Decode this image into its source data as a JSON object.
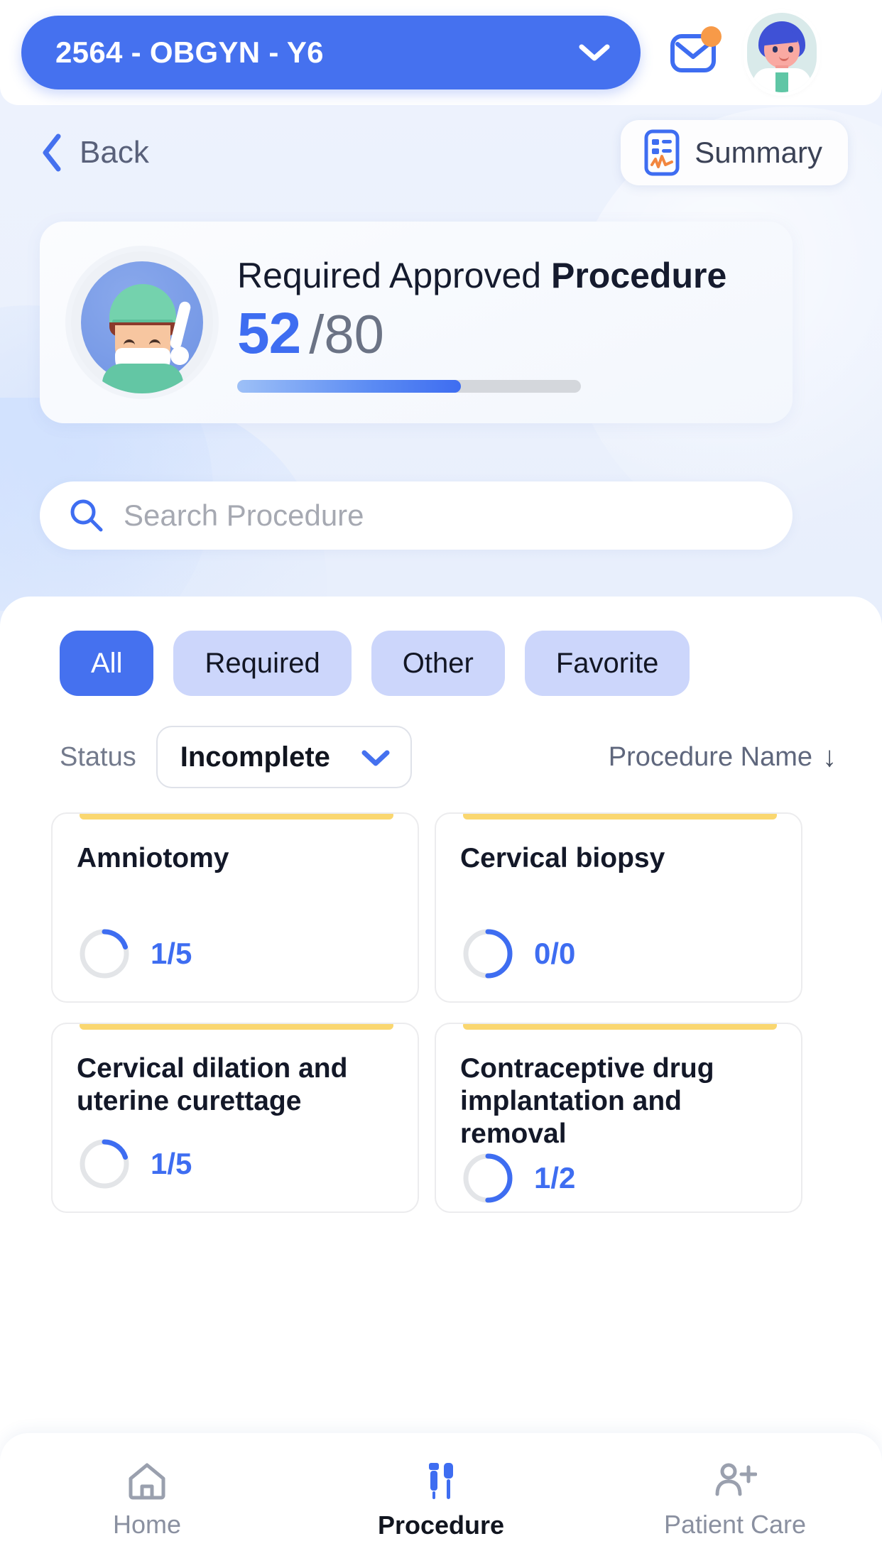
{
  "header": {
    "course_label": "2564 - OBGYN - Y6",
    "chevron_icon": "chevron-down-icon",
    "mail_icon": "mail-icon",
    "mail_has_badge": true,
    "avatar_icon": "user-avatar"
  },
  "navrow": {
    "back_label": "Back",
    "back_icon": "chevron-left-icon",
    "summary_label": "Summary",
    "summary_icon": "report-chart-icon"
  },
  "hero": {
    "title_prefix": "Required Approved ",
    "title_bold": "Procedure",
    "completed": "52",
    "total": "/80",
    "progress_percent": 65,
    "avatar_icon": "surgeon-avatar",
    "accent_color": "#3e6df1",
    "track_color": "#d4d7dc"
  },
  "search": {
    "placeholder": "Search Procedure",
    "icon": "search-icon"
  },
  "filters": {
    "chips": [
      {
        "label": "All",
        "active": true
      },
      {
        "label": "Required",
        "active": false
      },
      {
        "label": "Other",
        "active": false
      },
      {
        "label": "Favorite",
        "active": false
      }
    ],
    "status_label": "Status",
    "status_value": "Incomplete",
    "status_chevron_icon": "chevron-down-icon",
    "sort_label": "Procedure Name",
    "sort_arrow": "↓",
    "sort_icon": "arrow-down-icon"
  },
  "procedures": [
    {
      "name": "Amniotomy",
      "count": "1/5",
      "done": 1,
      "total": 5,
      "percent": 20,
      "accent_color": "#fad770"
    },
    {
      "name": "Cervical biopsy",
      "count": "0/0",
      "done": 0,
      "total": 0,
      "percent": 50,
      "accent_color": "#fad770"
    },
    {
      "name": "Cervical dilation and uterine curettage",
      "count": "1/5",
      "done": 1,
      "total": 5,
      "percent": 20,
      "accent_color": "#fad770"
    },
    {
      "name": "Contraceptive drug implantation and removal",
      "count": "1/2",
      "done": 1,
      "total": 2,
      "percent": 50,
      "accent_color": "#fad770"
    }
  ],
  "bottomnav": [
    {
      "label": "Home",
      "icon": "home-icon",
      "active": false
    },
    {
      "label": "Procedure",
      "icon": "syringe-icon",
      "active": true
    },
    {
      "label": "Patient Care",
      "icon": "patient-care-icon",
      "active": false
    }
  ]
}
